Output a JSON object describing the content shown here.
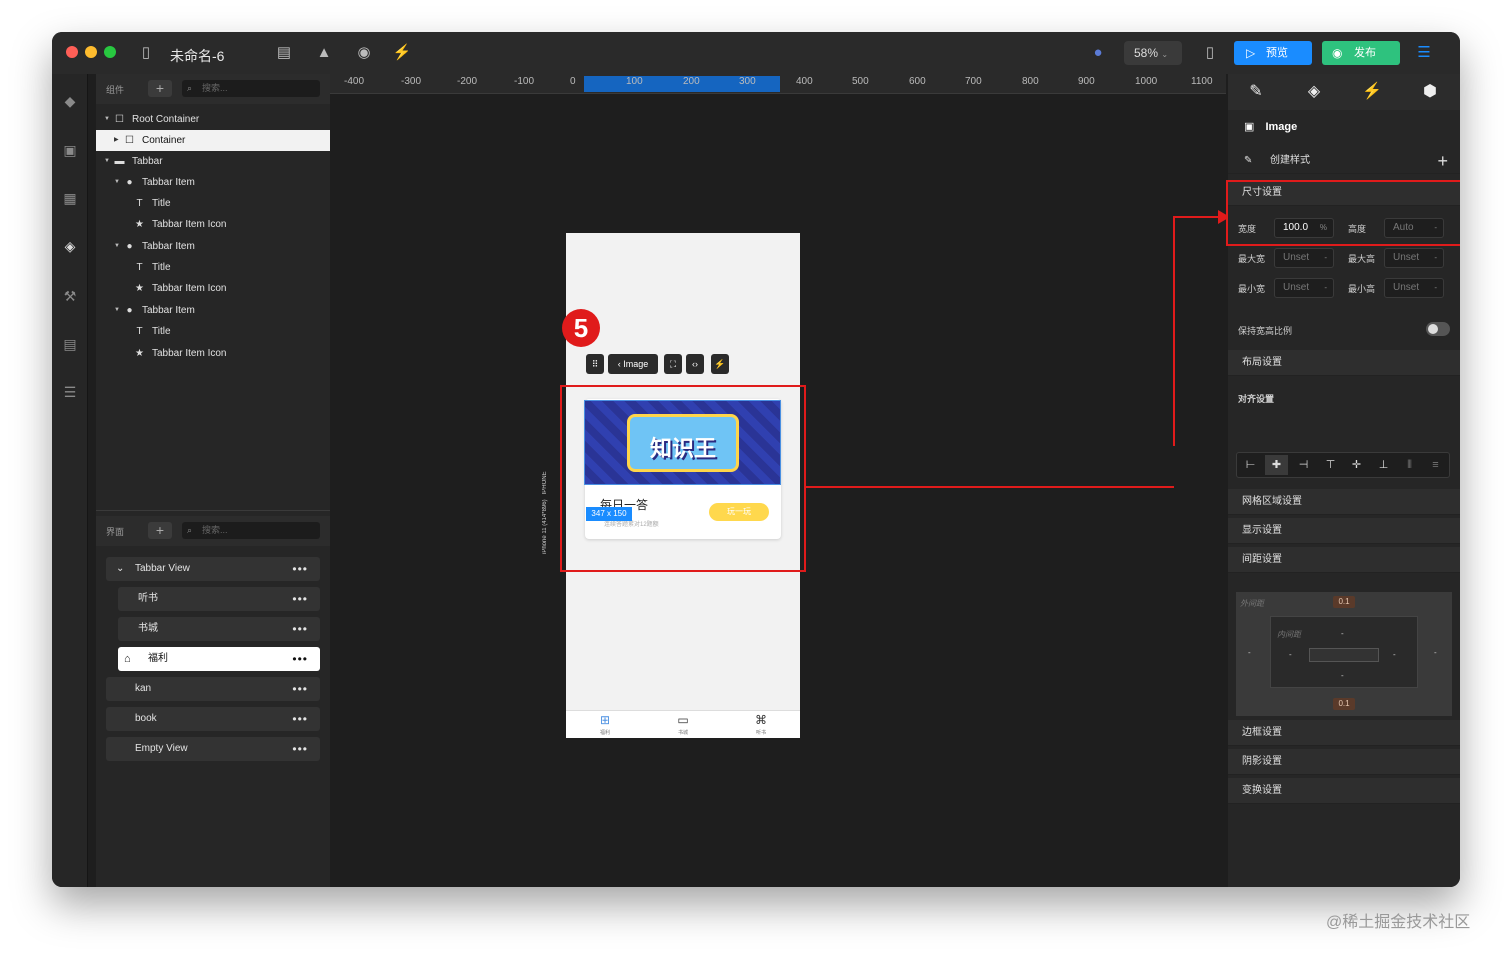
{
  "window": {
    "title": "未命名-6",
    "zoom": "58%",
    "preview_label": "预览",
    "publish_label": "发布"
  },
  "components_panel": {
    "label": "组件",
    "search_placeholder": "搜索...",
    "tree": [
      {
        "label": "Root Container",
        "icon": "square-icon",
        "expanded": true
      },
      {
        "label": "Container",
        "icon": "square-icon",
        "selected": true
      },
      {
        "label": "Tabbar",
        "icon": "tabbar-icon",
        "expanded": true
      },
      {
        "label": "Tabbar Item",
        "icon": "group-icon",
        "expanded": true
      },
      {
        "label": "Title",
        "icon": "text-icon"
      },
      {
        "label": "Tabbar Item Icon",
        "icon": "star-icon"
      },
      {
        "label": "Tabbar Item",
        "icon": "group-icon",
        "expanded": true
      },
      {
        "label": "Title",
        "icon": "text-icon"
      },
      {
        "label": "Tabbar Item Icon",
        "icon": "star-icon"
      },
      {
        "label": "Tabbar Item",
        "icon": "group-icon",
        "expanded": true
      },
      {
        "label": "Title",
        "icon": "text-icon"
      },
      {
        "label": "Tabbar Item Icon",
        "icon": "star-icon"
      }
    ]
  },
  "pages_panel": {
    "label": "界面",
    "search_placeholder": "搜索...",
    "pages": [
      {
        "label": "Tabbar View"
      },
      {
        "label": "听书"
      },
      {
        "label": "书城"
      },
      {
        "label": "福利",
        "selected": true
      },
      {
        "label": "kan"
      },
      {
        "label": "book"
      },
      {
        "label": "Empty View"
      }
    ],
    "dots": "•••"
  },
  "ruler": {
    "ticks": [
      "-400",
      "-300",
      "-200",
      "-100",
      "0",
      "100",
      "200",
      "300",
      "400",
      "500",
      "600",
      "700",
      "800",
      "900",
      "1000",
      "1100"
    ]
  },
  "canvas": {
    "step_number": "5",
    "float_toolbar_label": "Image",
    "size_badge": "347 x 150",
    "banner_text": "知识王",
    "card_title": "每日一答",
    "card_subtitle": "连续答题累对12题额",
    "play_button": "玩一玩",
    "device_label": "iPhone 11 (414*896)",
    "device_type": "IPHONE",
    "tabs": [
      {
        "icon": "gift-icon",
        "label": "福利"
      },
      {
        "icon": "book-icon",
        "label": "书城"
      },
      {
        "icon": "command-icon",
        "label": "听书"
      }
    ]
  },
  "inspector": {
    "element_name": "Image",
    "create_style": "创建样式",
    "size_section": "尺寸设置",
    "width_label": "宽度",
    "width_value": "100.0",
    "width_unit": "%",
    "height_label": "高度",
    "height_value": "Auto",
    "max_width_label": "最大宽",
    "max_height_label": "最大高",
    "min_width_label": "最小宽",
    "min_height_label": "最小高",
    "unset": "Unset",
    "dash": "-",
    "keep_ratio": "保持宽高比例",
    "layout_section": "布局设置",
    "align_section": "对齐设置",
    "grid_section": "网格区域设置",
    "display_section": "显示设置",
    "spacing_section": "间距设置",
    "outer_spacing": "外间距",
    "inner_spacing": "内间距",
    "spacing_top": "0.1",
    "spacing_bottom": "0.1",
    "border_section": "边框设置",
    "shadow_section": "阴影设置",
    "transform_section": "变换设置"
  },
  "watermark": "@稀土掘金技术社区",
  "colors": {
    "accent_red": "#e01b1b",
    "preview_blue": "#1a8cff",
    "publish_green": "#2ec27e"
  }
}
